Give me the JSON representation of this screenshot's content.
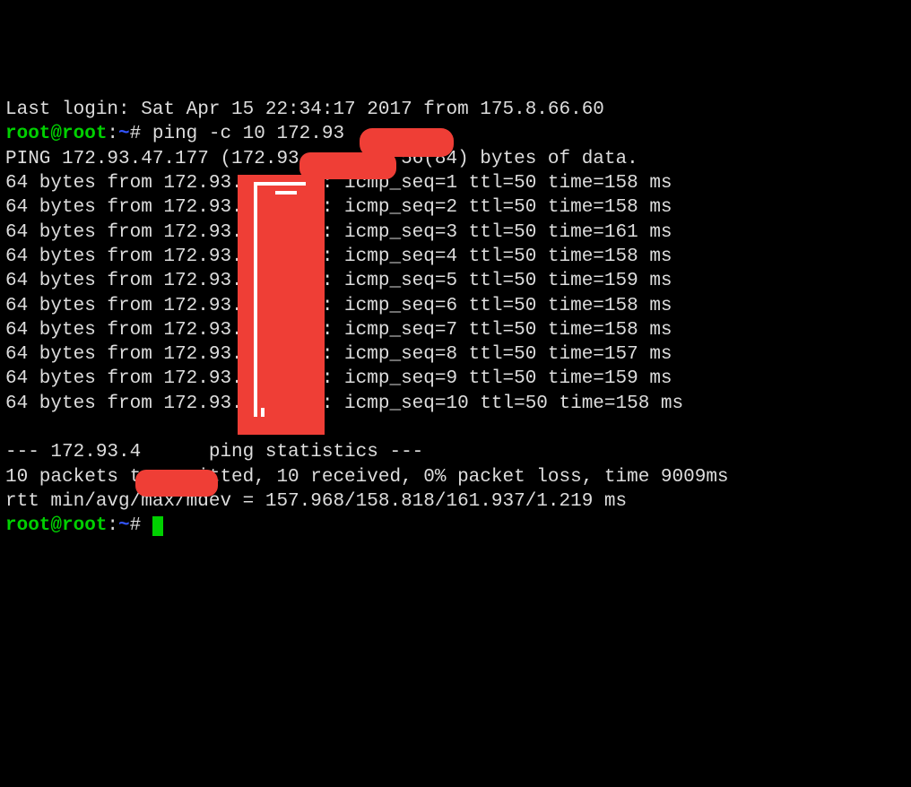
{
  "last_login": "Last login: Sat Apr 15 22:34:17 2017 from 175.8.66.60",
  "prompt": {
    "user_host": "root@root",
    "sep": ":",
    "path": "~",
    "end": "# "
  },
  "cmd": "ping -c 10 172.93",
  "hdr": "PING 172.93.47.177 (172.93.      ) 56(84) bytes of data.",
  "replies": [
    "64 bytes from 172.93.       : icmp_seq=1 ttl=50 time=158 ms",
    "64 bytes from 172.93.       : icmp_seq=2 ttl=50 time=158 ms",
    "64 bytes from 172.93.       : icmp_seq=3 ttl=50 time=161 ms",
    "64 bytes from 172.93.       : icmp_seq=4 ttl=50 time=158 ms",
    "64 bytes from 172.93.       : icmp_seq=5 ttl=50 time=159 ms",
    "64 bytes from 172.93.       : icmp_seq=6 ttl=50 time=158 ms",
    "64 bytes from 172.93.       : icmp_seq=7 ttl=50 time=158 ms",
    "64 bytes from 172.93.       : icmp_seq=8 ttl=50 time=157 ms",
    "64 bytes from 172.93.       : icmp_seq=9 ttl=50 time=159 ms",
    "64 bytes from 172.93.       : icmp_seq=10 ttl=50 time=158 ms"
  ],
  "blank": "",
  "stats_hdr": "--- 172.93.4      ping statistics ---",
  "stats1": "10 packets transmitted, 10 received, 0% packet loss, time 9009ms",
  "stats2": "rtt min/avg/max/mdev = 157.968/158.818/161.937/1.219 ms"
}
